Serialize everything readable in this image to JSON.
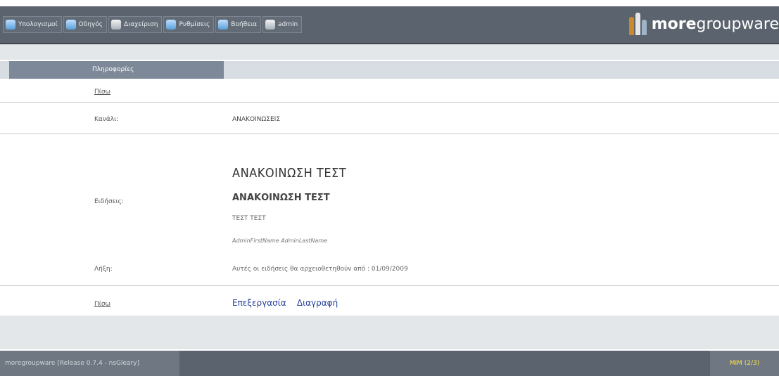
{
  "nav": {
    "items": [
      {
        "label": "Υπολογισμοί",
        "icon": "computer-icon"
      },
      {
        "label": "Οδηγός",
        "icon": "arrow-right-icon"
      },
      {
        "label": "Διαχείριση",
        "icon": "tools-icon"
      },
      {
        "label": "Ρυθμίσεις",
        "icon": "settings-icon"
      },
      {
        "label": "Βοήθεια",
        "icon": "help-icon"
      },
      {
        "label": "admin",
        "icon": "user-icon"
      }
    ]
  },
  "logo": {
    "part1": "more",
    "part2": "groupware"
  },
  "tab": {
    "label": "Πληροφορίες"
  },
  "form": {
    "back_top": "Πίσω",
    "channel_label": "Κανάλι:",
    "channel_value": "ΑΝΑΚΟΙΝΩΣΕΙΣ",
    "news_label": "Ειδήσεις:",
    "news_title": "ΑΝΑΚΟΙΝΩΣΗ ΤΕΣΤ",
    "news_subtitle": "ΑΝΑΚΟΙΝΩΣΗ ΤΕΣΤ",
    "news_body": "ΤΕΣΤ ΤΕΣΤ",
    "news_author": "AdminFirstName AdminLastName",
    "expiry_label": "Λήξη:",
    "expiry_text": "Αυτές οι ειδήσεις θα αρχειοθετηθούν από : 01/09/2009",
    "back_bottom": "Πίσω",
    "edit_label": "Επεξεργασία",
    "delete_label": "Διαγραφή"
  },
  "footer": {
    "release": "moregroupware [Release 0.7.4 - nsGleary]",
    "page": "MIM (2/3)"
  },
  "colors": {
    "topbar": "#5b646e",
    "tab": "#7d8998",
    "link": "#27409a",
    "footer_accent": "#ffe24a"
  }
}
